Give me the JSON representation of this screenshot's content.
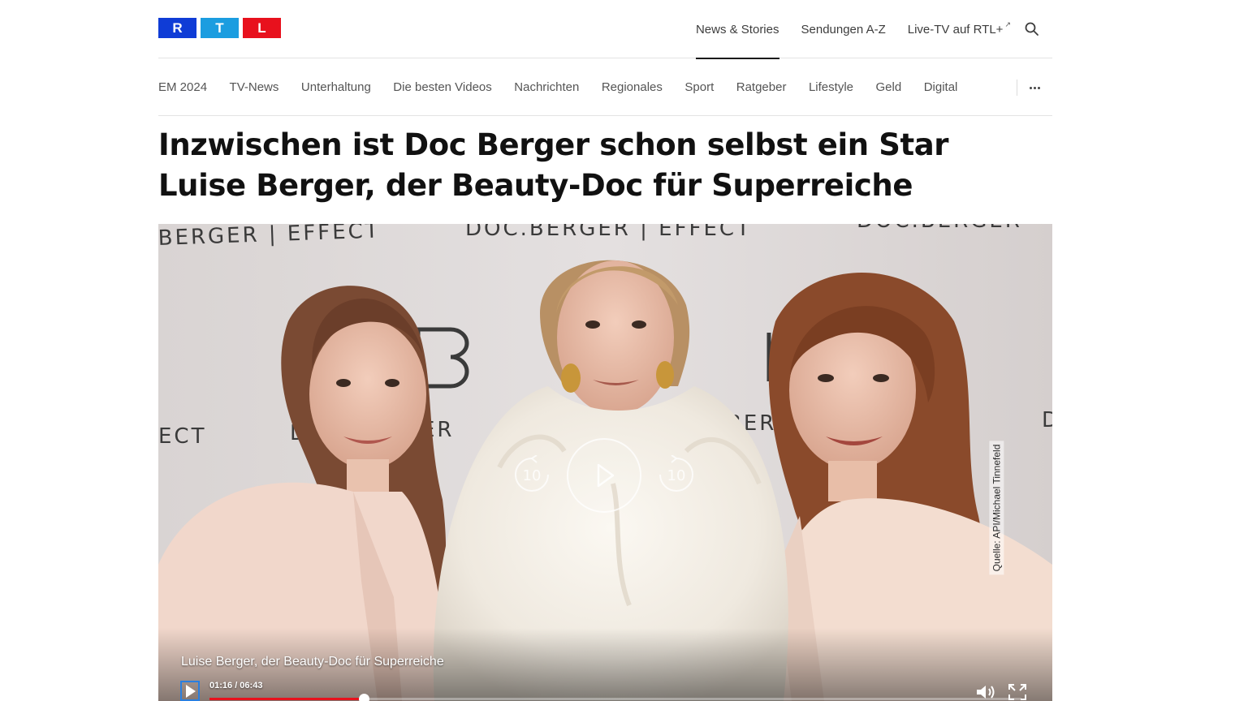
{
  "logo": {
    "letters": [
      "R",
      "T",
      "L"
    ]
  },
  "main_nav": {
    "items": [
      {
        "label": "News & Stories",
        "active": true
      },
      {
        "label": "Sendungen A-Z",
        "active": false
      },
      {
        "label": "Live-TV auf RTL+",
        "external_mark": "↗",
        "active": false
      }
    ]
  },
  "sub_nav": {
    "items": [
      "EM 2024",
      "TV-News",
      "Unterhaltung",
      "Die besten Videos",
      "Nachrichten",
      "Regionales",
      "Sport",
      "Ratgeber",
      "Lifestyle",
      "Geld",
      "Digital"
    ]
  },
  "article": {
    "kicker": "Inzwischen ist Doc Berger schon selbst ein Star",
    "title": "Luise Berger, der Beauty-Doc für Superreiche"
  },
  "video": {
    "backdrop_text": [
      "BERGER | EFFECT",
      "DOC.BERGER | EFFECT",
      "DOC.BERGER",
      "ECT",
      "D",
      "ER",
      "BERG",
      "D"
    ],
    "credit": "Quelle: API/Michael Tinnefeld",
    "caption": "Luise Berger, der Beauty-Doc für Superreiche",
    "time_current": "01:16",
    "time_total": "06:43",
    "time_display": "01:16 / 06:43",
    "progress": 0.19,
    "skip_back_seconds": "10",
    "skip_forward_seconds": "10"
  },
  "colors": {
    "logo_r": "#0f3cd6",
    "logo_t": "#1b9de0",
    "logo_l": "#e8111d",
    "progress": "#e8111d"
  },
  "icons": {
    "search": "search-icon",
    "more": "more-icon",
    "play": "play-icon",
    "rewind": "rewind-10-icon",
    "forward": "forward-10-icon",
    "volume": "volume-icon",
    "fullscreen": "fullscreen-icon"
  }
}
